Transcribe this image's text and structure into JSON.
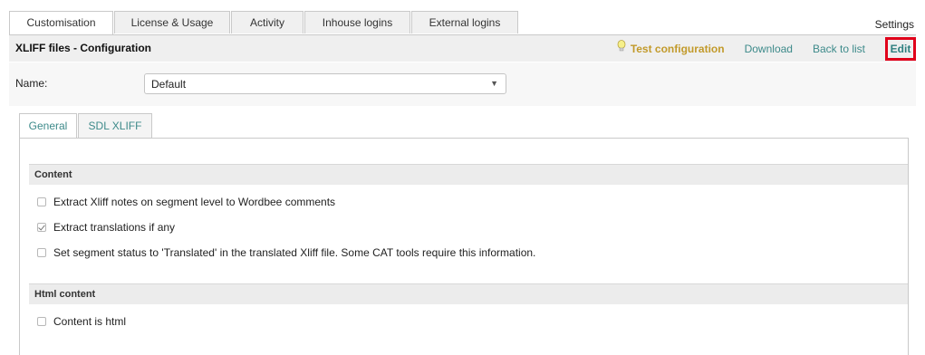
{
  "top_tabs": [
    "Customisation",
    "License & Usage",
    "Activity",
    "Inhouse logins",
    "External logins"
  ],
  "settings_label": "Settings",
  "page_title": "XLIFF files - Configuration",
  "actions": {
    "test": "Test configuration",
    "download": "Download",
    "back": "Back to list",
    "edit": "Edit"
  },
  "name": {
    "label": "Name:",
    "value": "Default"
  },
  "sub_tabs": [
    "General",
    "SDL XLIFF"
  ],
  "sections": [
    {
      "title": "Content",
      "options": [
        {
          "label": "Extract Xliff notes on segment level to Wordbee comments",
          "checked": false
        },
        {
          "label": "Extract translations if any",
          "checked": true
        },
        {
          "label": "Set segment status to 'Translated' in the translated Xliff file. Some CAT tools require this information.",
          "checked": false
        }
      ]
    },
    {
      "title": "Html content",
      "options": [
        {
          "label": "Content is html",
          "checked": false
        }
      ]
    }
  ],
  "colors": {
    "accent_link": "#3d8a8a",
    "test_link": "#c29a2a",
    "edit_highlight": "#e0001a"
  }
}
